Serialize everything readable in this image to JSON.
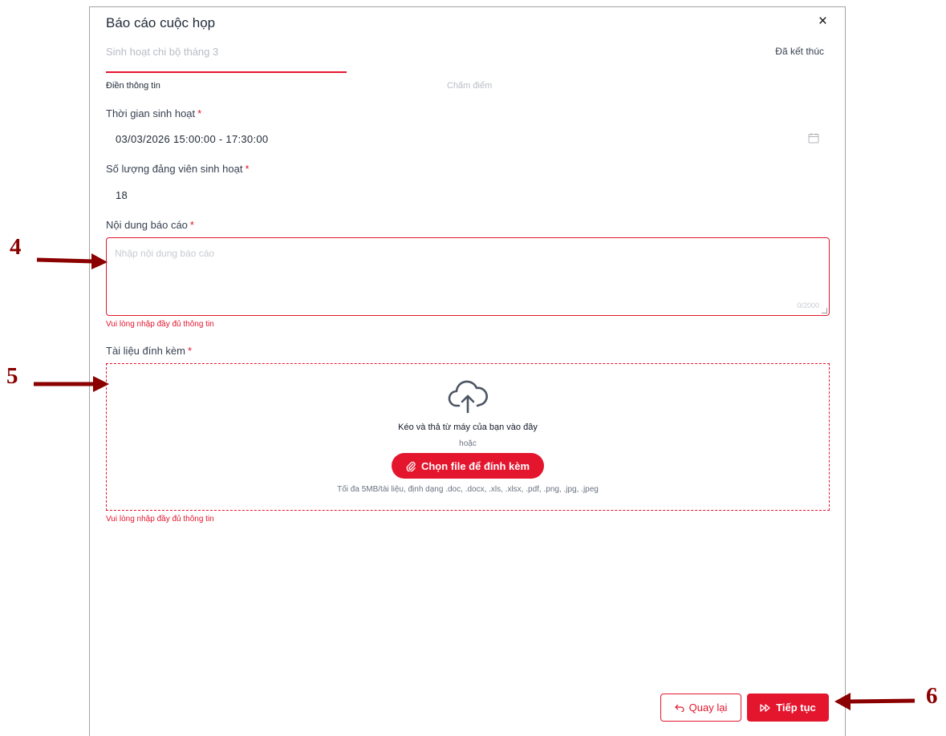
{
  "modal": {
    "title": "Báo cáo cuộc họp",
    "close_label": "×",
    "subtitle": "Sinh hoạt chi bộ tháng 3",
    "status": "Đã kết thúc"
  },
  "tabs": [
    {
      "label": "Điền thông tin",
      "active": true
    },
    {
      "label": "Chấm điểm",
      "active": false
    }
  ],
  "form": {
    "time": {
      "label": "Thời gian sinh hoạt",
      "required_mark": "*",
      "value": "03/03/2026 15:00:00 - 17:30:00",
      "icon": "calendar-icon"
    },
    "members": {
      "label": "Số lượng đảng viên sinh hoạt",
      "required_mark": "*",
      "value": "18"
    },
    "content": {
      "label": "Nội dung báo cáo",
      "required_mark": "*",
      "placeholder": "Nhập nội dung báo cáo",
      "value": "",
      "counter": "0/2000",
      "error": "Vui lòng nhập đầy đủ thông tin"
    },
    "attachment": {
      "label": "Tài liệu đính kèm",
      "required_mark": "*",
      "drag_text": "Kéo và thả từ máy của bạn vào đây",
      "or_text": "hoặc",
      "choose_label": "Chọn file để đính kèm",
      "limits": "Tối đa 5MB/tài liệu, định dạng .doc, .docx, .xls, .xlsx, .pdf, .png, .jpg, .jpeg",
      "error": "Vui lòng nhập đầy đủ thông tin",
      "icon": "cloud-upload-icon"
    }
  },
  "footer": {
    "back_label": "Quay lại",
    "next_label": "Tiếp tục"
  },
  "annotations": [
    "4",
    "5",
    "6"
  ],
  "colors": {
    "accent": "#e3162e",
    "annotation": "#8b0000"
  }
}
